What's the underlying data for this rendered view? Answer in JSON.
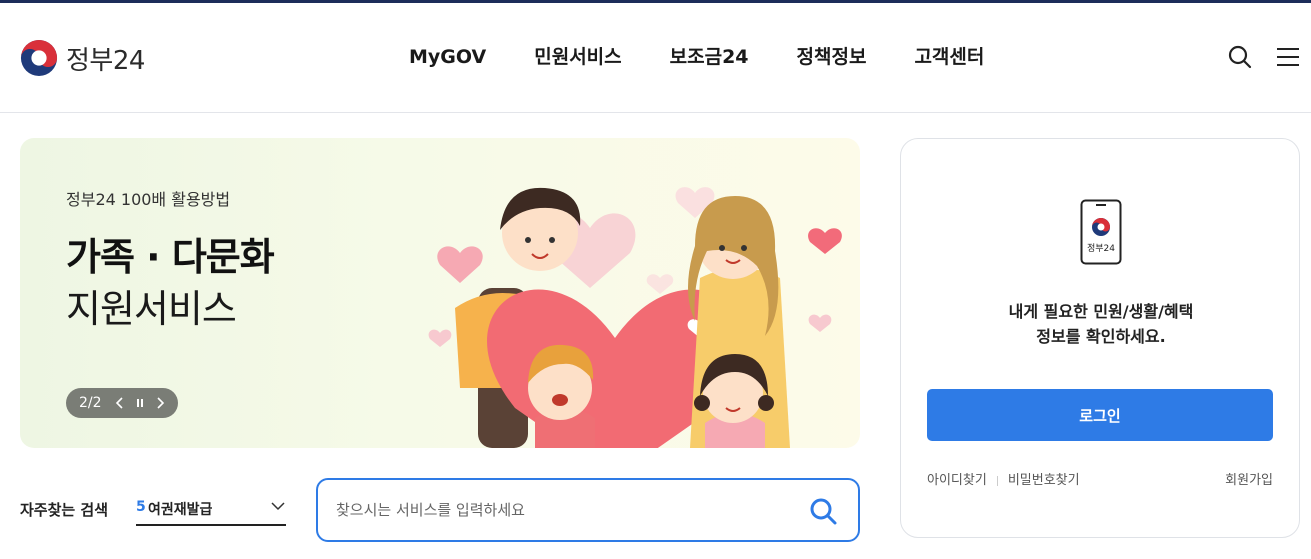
{
  "brand": {
    "name": "정부24"
  },
  "nav": [
    "MyGOV",
    "민원서비스",
    "보조금24",
    "정책정보",
    "고객센터"
  ],
  "banner": {
    "eyebrow": "정부24 100배 활용방법",
    "title": "가족 · 다문화",
    "subtitle": "지원서비스",
    "counter": "2/2"
  },
  "login": {
    "phone_label": "정부24",
    "message_line1": "내게 필요한 민원/생활/혜택",
    "message_line2": "정보를 확인하세요.",
    "button": "로그인",
    "find_id": "아이디찾기",
    "find_pw": "비밀번호찾기",
    "signup": "회원가입"
  },
  "frequent": {
    "label": "자주찾는 검색",
    "rank": "5",
    "term": "여권재발급"
  },
  "search": {
    "placeholder": "찾으시는 서비스를 입력하세요"
  },
  "colors": {
    "accent": "#2e7be6",
    "topline": "#1c2d5a",
    "banner_bg": "#f3f8e6"
  },
  "icons": [
    "taeguk-logo-icon",
    "search-icon",
    "hamburger-menu-icon",
    "chevron-left-icon",
    "pause-icon",
    "chevron-right-icon",
    "phone-icon",
    "chevron-down-icon"
  ]
}
